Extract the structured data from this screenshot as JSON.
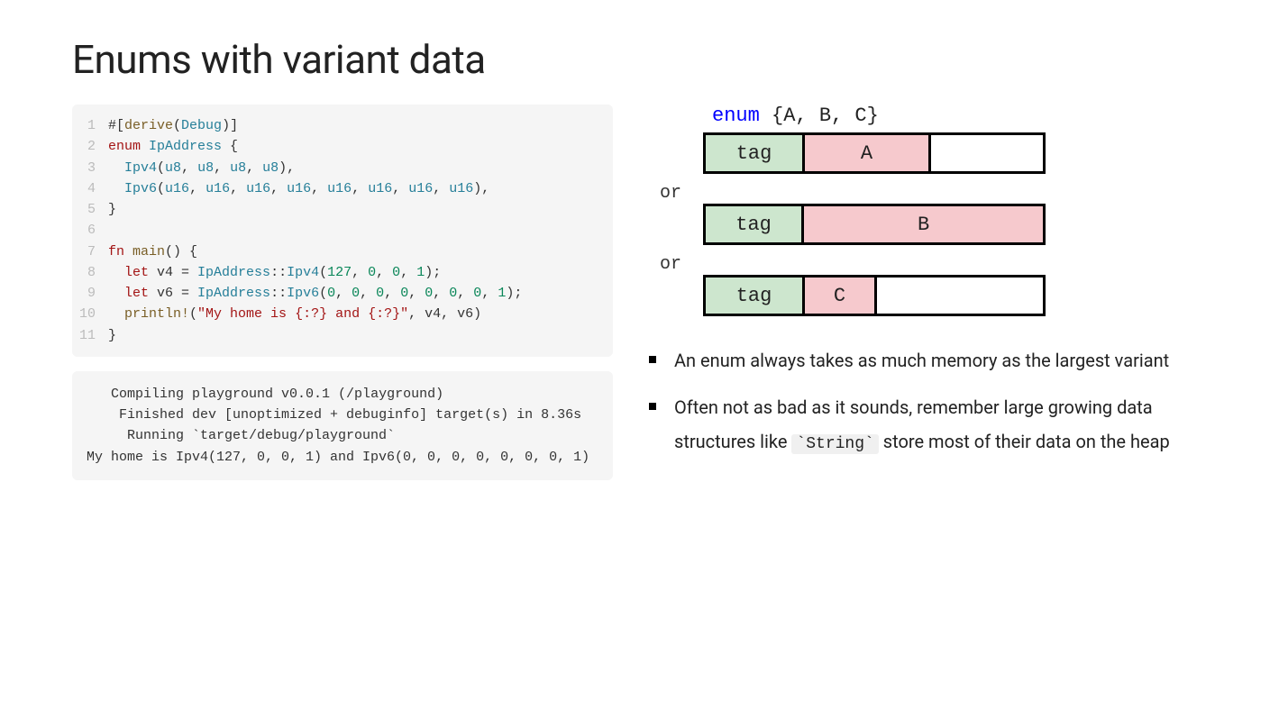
{
  "title": "Enums with variant data",
  "code": {
    "lines": [
      {
        "n": "1",
        "tokens": [
          [
            "tok-default",
            "#["
          ],
          [
            "tok-call",
            "derive"
          ],
          [
            "tok-default",
            "("
          ],
          [
            "tok-type",
            "Debug"
          ],
          [
            "tok-default",
            ")]"
          ]
        ]
      },
      {
        "n": "2",
        "tokens": [
          [
            "tok-kw",
            "enum"
          ],
          [
            "tok-default",
            " "
          ],
          [
            "tok-type",
            "IpAddress"
          ],
          [
            "tok-default",
            " {"
          ]
        ]
      },
      {
        "n": "3",
        "tokens": [
          [
            "tok-default",
            "  "
          ],
          [
            "tok-type",
            "Ipv4"
          ],
          [
            "tok-default",
            "("
          ],
          [
            "tok-type",
            "u8"
          ],
          [
            "tok-default",
            ", "
          ],
          [
            "tok-type",
            "u8"
          ],
          [
            "tok-default",
            ", "
          ],
          [
            "tok-type",
            "u8"
          ],
          [
            "tok-default",
            ", "
          ],
          [
            "tok-type",
            "u8"
          ],
          [
            "tok-default",
            "),"
          ]
        ]
      },
      {
        "n": "4",
        "tokens": [
          [
            "tok-default",
            "  "
          ],
          [
            "tok-type",
            "Ipv6"
          ],
          [
            "tok-default",
            "("
          ],
          [
            "tok-type",
            "u16"
          ],
          [
            "tok-default",
            ", "
          ],
          [
            "tok-type",
            "u16"
          ],
          [
            "tok-default",
            ", "
          ],
          [
            "tok-type",
            "u16"
          ],
          [
            "tok-default",
            ", "
          ],
          [
            "tok-type",
            "u16"
          ],
          [
            "tok-default",
            ", "
          ],
          [
            "tok-type",
            "u16"
          ],
          [
            "tok-default",
            ", "
          ],
          [
            "tok-type",
            "u16"
          ],
          [
            "tok-default",
            ", "
          ],
          [
            "tok-type",
            "u16"
          ],
          [
            "tok-default",
            ", "
          ],
          [
            "tok-type",
            "u16"
          ],
          [
            "tok-default",
            "),"
          ]
        ]
      },
      {
        "n": "5",
        "tokens": [
          [
            "tok-default",
            "}"
          ]
        ]
      },
      {
        "n": "6",
        "tokens": [
          [
            "tok-default",
            ""
          ]
        ]
      },
      {
        "n": "7",
        "tokens": [
          [
            "tok-kw",
            "fn"
          ],
          [
            "tok-default",
            " "
          ],
          [
            "tok-call",
            "main"
          ],
          [
            "tok-default",
            "() {"
          ]
        ]
      },
      {
        "n": "8",
        "tokens": [
          [
            "tok-default",
            "  "
          ],
          [
            "tok-kw",
            "let"
          ],
          [
            "tok-default",
            " v4 = "
          ],
          [
            "tok-type",
            "IpAddress"
          ],
          [
            "tok-default",
            "::"
          ],
          [
            "tok-type",
            "Ipv4"
          ],
          [
            "tok-default",
            "("
          ],
          [
            "tok-num",
            "127"
          ],
          [
            "tok-default",
            ", "
          ],
          [
            "tok-num",
            "0"
          ],
          [
            "tok-default",
            ", "
          ],
          [
            "tok-num",
            "0"
          ],
          [
            "tok-default",
            ", "
          ],
          [
            "tok-num",
            "1"
          ],
          [
            "tok-default",
            ");"
          ]
        ]
      },
      {
        "n": "9",
        "tokens": [
          [
            "tok-default",
            "  "
          ],
          [
            "tok-kw",
            "let"
          ],
          [
            "tok-default",
            " v6 = "
          ],
          [
            "tok-type",
            "IpAddress"
          ],
          [
            "tok-default",
            "::"
          ],
          [
            "tok-type",
            "Ipv6"
          ],
          [
            "tok-default",
            "("
          ],
          [
            "tok-num",
            "0"
          ],
          [
            "tok-default",
            ", "
          ],
          [
            "tok-num",
            "0"
          ],
          [
            "tok-default",
            ", "
          ],
          [
            "tok-num",
            "0"
          ],
          [
            "tok-default",
            ", "
          ],
          [
            "tok-num",
            "0"
          ],
          [
            "tok-default",
            ", "
          ],
          [
            "tok-num",
            "0"
          ],
          [
            "tok-default",
            ", "
          ],
          [
            "tok-num",
            "0"
          ],
          [
            "tok-default",
            ", "
          ],
          [
            "tok-num",
            "0"
          ],
          [
            "tok-default",
            ", "
          ],
          [
            "tok-num",
            "1"
          ],
          [
            "tok-default",
            ");"
          ]
        ]
      },
      {
        "n": "10",
        "tokens": [
          [
            "tok-default",
            "  "
          ],
          [
            "tok-call",
            "println!"
          ],
          [
            "tok-default",
            "("
          ],
          [
            "tok-str",
            "\"My home is {:?} and {:?}\""
          ],
          [
            "tok-default",
            ", v4, v6)"
          ]
        ]
      },
      {
        "n": "11",
        "tokens": [
          [
            "tok-default",
            "}"
          ]
        ]
      }
    ]
  },
  "output": "   Compiling playground v0.0.1 (/playground)\n    Finished dev [unoptimized + debuginfo] target(s) in 8.36s\n     Running `target/debug/playground`\nMy home is Ipv4(127, 0, 0, 1) and Ipv6(0, 0, 0, 0, 0, 0, 0, 1)",
  "diagram": {
    "title_kw": "enum",
    "title_rest": " {A, B, C}",
    "or": "or",
    "rows": [
      {
        "tag": "tag",
        "data": "A",
        "data_width": 140,
        "empty_width": 1
      },
      {
        "tag": "tag",
        "data": "B",
        "data_width": 267,
        "empty_width": 0
      },
      {
        "tag": "tag",
        "data": "C",
        "data_width": 80,
        "empty_width": 1
      }
    ]
  },
  "bullets": [
    {
      "parts": [
        {
          "t": "text",
          "v": "An enum always takes as much memory as the largest variant"
        }
      ]
    },
    {
      "parts": [
        {
          "t": "text",
          "v": "Often not as bad as it sounds, remember large growing data structures like "
        },
        {
          "t": "code",
          "v": "`String`"
        },
        {
          "t": "text",
          "v": " store most of their data on the heap"
        }
      ]
    }
  ]
}
